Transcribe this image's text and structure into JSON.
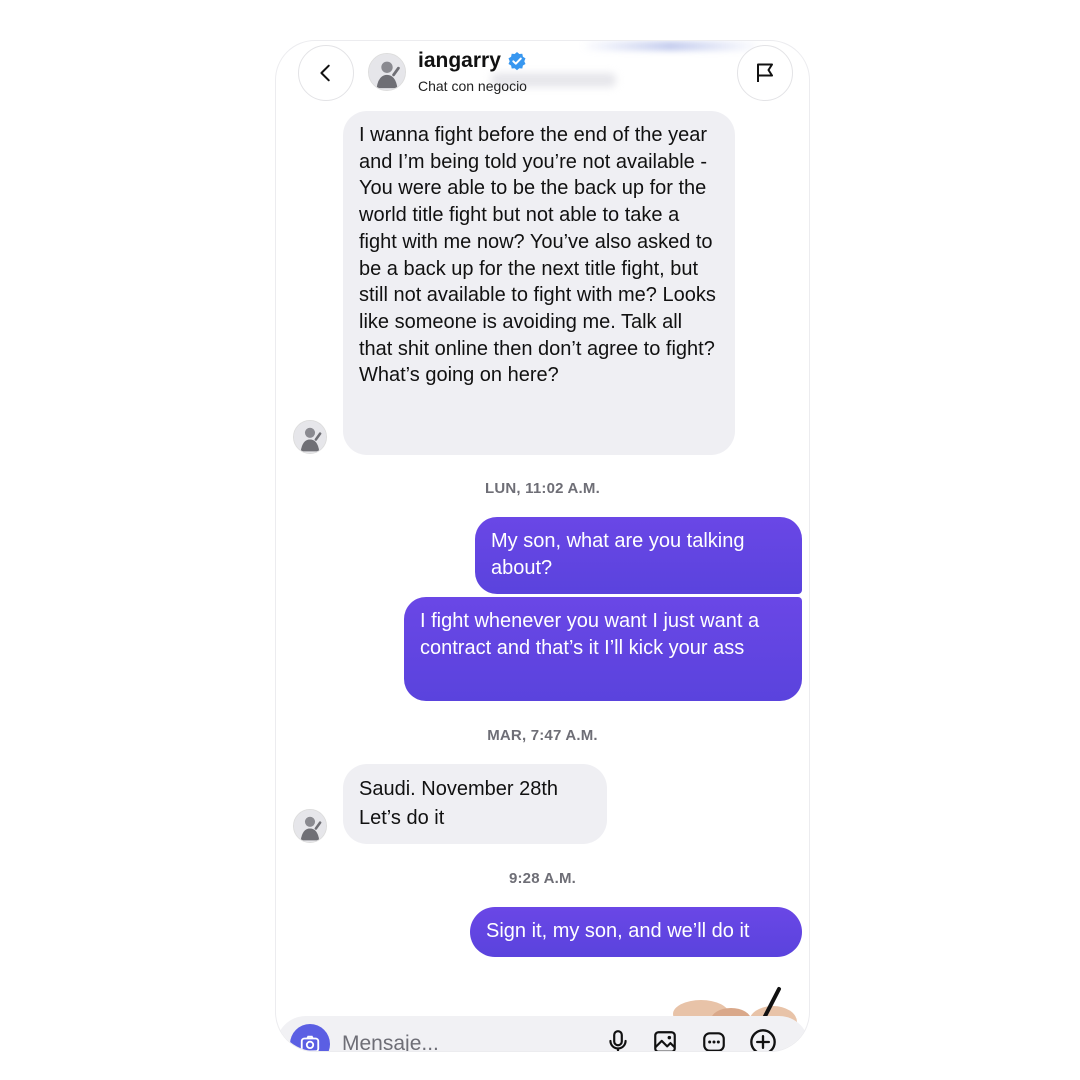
{
  "header": {
    "username": "iangarry",
    "subtitle": "Chat con negocio"
  },
  "messages": [
    {
      "from": "them",
      "text": "I wanna fight before the end of the year and I’m being told you’re not available - You were able to be the back up for the world title fight but not able to take a fight with me now? You’ve also asked to be a back up for the next title fight, but still not available to fight with me? Looks like someone is avoiding me. Talk all that shit online then don’t agree to fight? What’s going on here?"
    },
    {
      "timestamp": "LUN, 11:02 A.M."
    },
    {
      "from": "me",
      "text": "My son, what are you talking about?"
    },
    {
      "from": "me",
      "text": "I fight whenever you want I just want a contract and that’s it I’ll kick your ass"
    },
    {
      "timestamp": "MAR, 7:47 A.M."
    },
    {
      "from": "them",
      "text": "Saudi. November 28th\nLet’s do it"
    },
    {
      "timestamp": "9:28 A.M."
    },
    {
      "from": "me",
      "text": "Sign it, my son, and we’ll do it"
    }
  ],
  "composer": {
    "placeholder": "Mensaje..."
  },
  "colors": {
    "outgoing": "#5d44e0",
    "incoming": "#efeff3",
    "verified": "#3897f0",
    "camera": "#5b5fe3"
  },
  "icons": [
    "back-icon",
    "flag-icon",
    "verified-icon",
    "camera-icon",
    "microphone-icon",
    "gallery-icon",
    "sticker-icon",
    "plus-icon"
  ]
}
